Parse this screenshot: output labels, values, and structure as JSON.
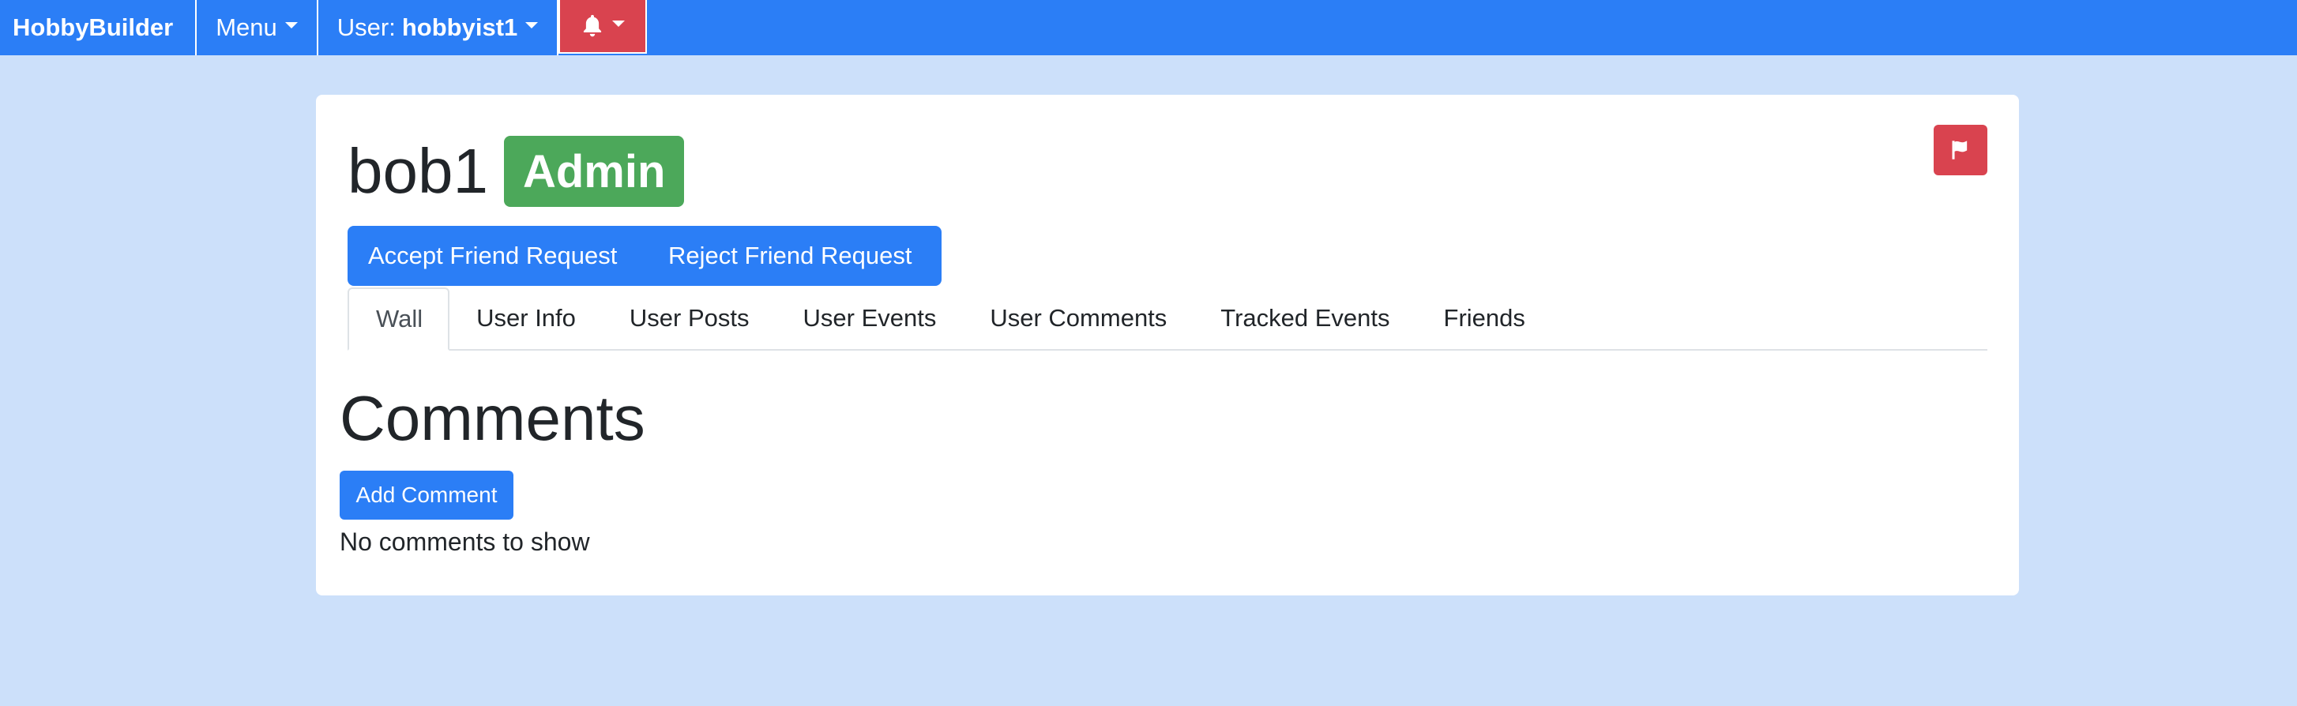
{
  "navbar": {
    "brand": "HobbyBuilder",
    "menu_label": "Menu",
    "user_prefix": "User:",
    "username": "hobbyist1",
    "notifications_icon": "bell-icon"
  },
  "profile": {
    "username": "bob1",
    "role_badge": "Admin",
    "report_icon": "flag-icon",
    "accept_label": "Accept Friend Request",
    "reject_label": "Reject Friend Request"
  },
  "tabs": [
    {
      "label": "Wall",
      "active": true
    },
    {
      "label": "User Info"
    },
    {
      "label": "User Posts"
    },
    {
      "label": "User Events"
    },
    {
      "label": "User Comments"
    },
    {
      "label": "Tracked Events"
    },
    {
      "label": "Friends"
    }
  ],
  "comments": {
    "heading": "Comments",
    "add_label": "Add Comment",
    "empty_message": "No comments to show"
  },
  "colors": {
    "primary": "#2b7ef6",
    "danger": "#d9434f",
    "success": "#4ca85a",
    "page_background": "#cce0fa"
  }
}
